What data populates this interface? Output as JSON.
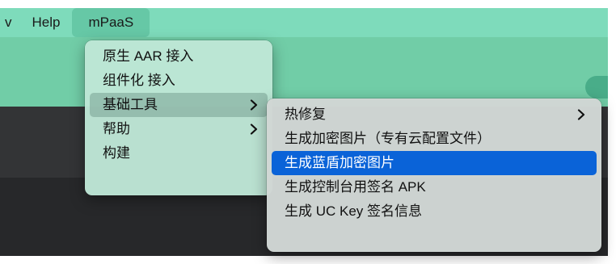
{
  "menubar": {
    "partial_item": "v",
    "help": "Help",
    "mpaas": "mPaaS"
  },
  "mpaas_menu": {
    "items": [
      {
        "label": "原生 AAR 接入"
      },
      {
        "label": "组件化 接入"
      },
      {
        "label": "基础工具"
      },
      {
        "label": "帮助"
      },
      {
        "label": "构建"
      }
    ]
  },
  "tools_submenu": {
    "items": [
      {
        "label": "热修复"
      },
      {
        "label": "生成加密图片（专有云配置文件）"
      },
      {
        "label": "生成蓝盾加密图片"
      },
      {
        "label": "生成控制台用签名 APK"
      },
      {
        "label": "生成 UC Key 签名信息"
      }
    ]
  },
  "colors": {
    "menubar_bg": "#7edbbb",
    "active_menu_bg": "#66c8a6",
    "selection": "#0a63d8",
    "editor_bg": "#333436"
  }
}
